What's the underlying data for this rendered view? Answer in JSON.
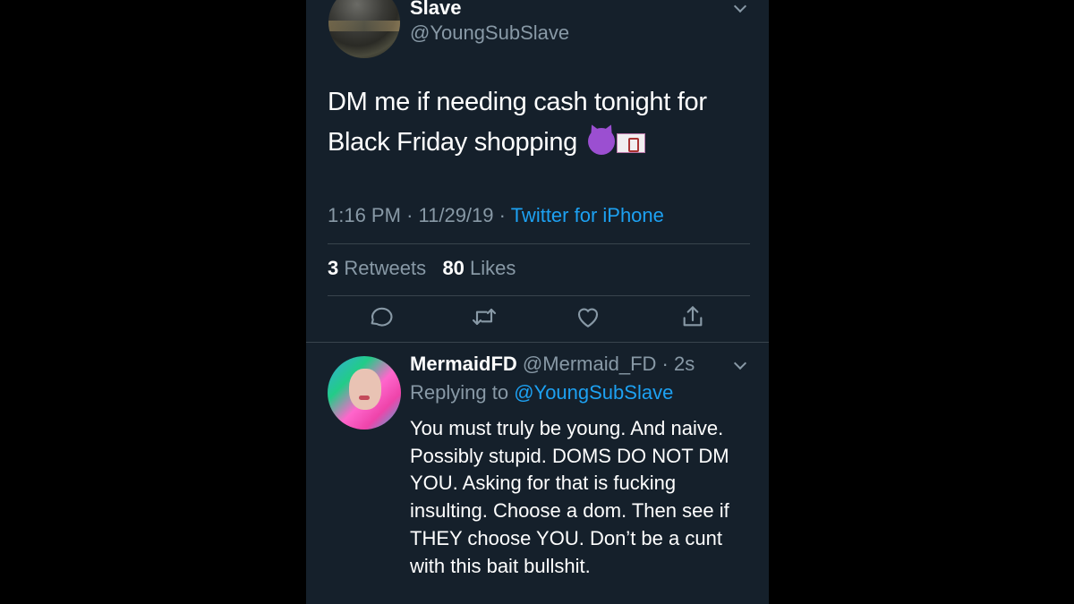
{
  "tweet": {
    "author_name": "Slave",
    "author_handle": "@YoungSubSlave",
    "text": "DM me if needing cash tonight for Black Friday shopping",
    "emojis": [
      "smiling-devil-emoji",
      "pound-banknote-emoji"
    ],
    "time": "1:16 PM",
    "date": "11/29/19",
    "source": "Twitter for iPhone",
    "retweet_count": "3",
    "retweet_label": "Retweets",
    "like_count": "80",
    "like_label": "Likes"
  },
  "actions": [
    "reply-icon",
    "retweet-icon",
    "like-icon",
    "share-icon"
  ],
  "reply": {
    "name": "MermaidFD",
    "handle": "@Mermaid_FD",
    "age": "2s",
    "replying_label": "Replying to",
    "replying_handle": "@YoungSubSlave",
    "text": "You must truly be young. And naive. Possibly stupid. DOMS DO NOT DM YOU. Asking for that is fucking insulting. Choose a dom. Then see if THEY choose YOU. Don’t be a cunt with this bait bullshit."
  },
  "colors": {
    "background": "#15202b",
    "letterbox": "#000000",
    "text": "#ffffff",
    "secondary": "#8899a6",
    "link": "#1da1f2",
    "divider": "#38444d"
  }
}
